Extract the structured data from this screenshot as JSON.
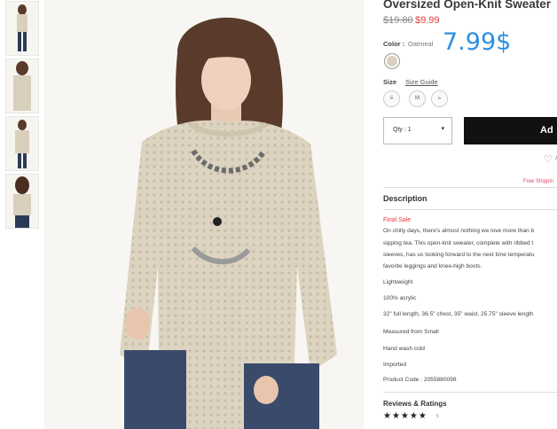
{
  "product": {
    "title": "Oversized Open-Knit Sweater",
    "price_original": "$19.80",
    "price_sale": "$9.99",
    "annotation": "7.99$",
    "color_label": "Color :",
    "color_value": "Oatmeal",
    "size_label": "Size",
    "size_guide_label": "Size Guide",
    "sizes": [
      "S",
      "M",
      "L"
    ],
    "qty_label": "Qty : 1",
    "qty_arrow": "▾",
    "add_button_label": "Ad",
    "wishlist_label": "A",
    "free_shipping": "Free Shippin"
  },
  "description": {
    "heading": "Description",
    "final_sale": "Final Sale",
    "paragraph": [
      "On chilly days, there's almost nothing we love more than b",
      "sipping tea. This open-knit sweater, complete with ribbed t",
      "sleeves, has us looking forward to the next time temperatu",
      "favorite leggings and knee-high boots."
    ],
    "details": [
      "Lightweight",
      "100% acrylic",
      "32\" full length, 36.5\" chest, 35\" waist, 25.75\" sleeve length",
      "Measured from Small",
      "Hand wash cold",
      "Imported",
      "Product Code : 2055880098"
    ]
  },
  "reviews": {
    "heading": "Reviews & Ratings",
    "stars": "★★★★★",
    "count": "5"
  },
  "colors": {
    "price_sale": "#e03a3a",
    "annotation": "#2e8ee0",
    "add_button": "#111111",
    "sweater": "#d9cfbd"
  },
  "icons": {
    "heart": "heart-icon",
    "dropdown": "chevron-down-icon"
  }
}
